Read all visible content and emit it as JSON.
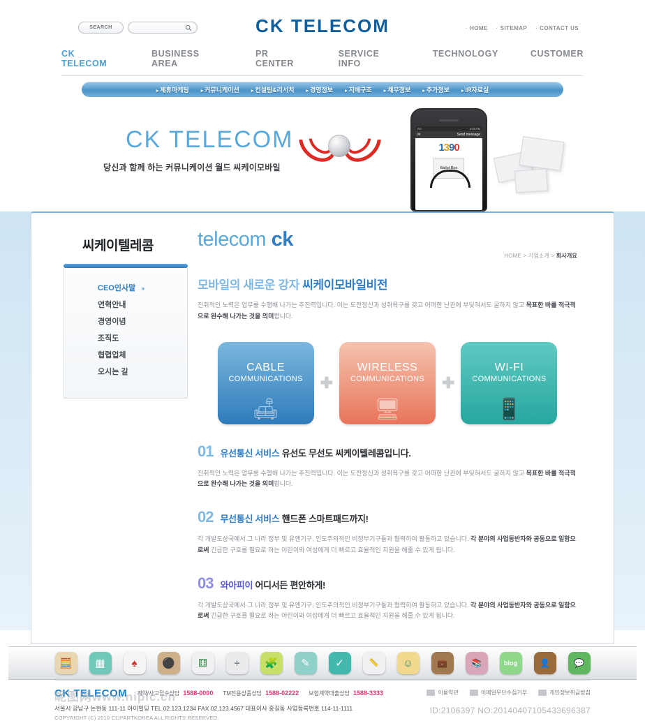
{
  "header": {
    "search_button_label": "SEARCH",
    "search_placeholder": "",
    "search_value": "",
    "brand": "CK TELECOM",
    "util_links": [
      "HOME",
      "SITEMAP",
      "CONTACT US"
    ]
  },
  "mainnav": [
    {
      "label": "CK TELECOM",
      "active": true
    },
    {
      "label": "BUSINESS AREA",
      "active": false
    },
    {
      "label": "PR CENTER",
      "active": false
    },
    {
      "label": "SERVICE INFO",
      "active": false
    },
    {
      "label": "TECHNOLOGY",
      "active": false
    },
    {
      "label": "CUSTOMER",
      "active": false
    }
  ],
  "subnav": [
    "제휴마케팅",
    "커뮤니케이션",
    "컨설팅&리서치",
    "경영정보",
    "지배구조",
    "채무정보",
    "추가정보",
    "IR자료실"
  ],
  "hero": {
    "title": "CK TELECOM",
    "tagline": "당신과 함께 하는 커뮤니케이션 월드 씨케이모바일",
    "phone": {
      "carrier": "RG",
      "time": "8:06 PM",
      "bar_label": "Send message",
      "number_parts": [
        "1",
        "3",
        "9",
        "0"
      ],
      "ballot_label": "Ballot Box"
    }
  },
  "sidebar": {
    "title": "씨케이텔레콤",
    "items": [
      {
        "label": "CEO인사말",
        "active": true
      },
      {
        "label": "연혁안내",
        "active": false
      },
      {
        "label": "경영이념",
        "active": false
      },
      {
        "label": "조직도",
        "active": false
      },
      {
        "label": "협렵업체",
        "active": false
      },
      {
        "label": "오시는 길",
        "active": false
      }
    ]
  },
  "content": {
    "logo_light": "telecom",
    "logo_bold": "ck",
    "breadcrumb_prefix": "HOME > 기업소개 > ",
    "breadcrumb_current": "회사개요",
    "section_title_light": "모바일의 새로운 강자 ",
    "section_title_dark": "씨케이모바일비전",
    "intro_plain_1": "진취적인 노력은 업무를 수행해 나가는 추진력입니다. 이는 도전정신과 성취욕구를 갖고 어떠한 난관에 부딪혀서도 굴하지 않고 ",
    "intro_bold_1": "목표한 바를 적극적으로 완수해 나가는 것을 의미",
    "intro_plain_2": "합니다.",
    "cards": [
      {
        "line1": "CABLE",
        "line2": "COMMUNICATIONS",
        "color": "#2f7cbb",
        "art": "🛋"
      },
      {
        "line1": "WIRELESS",
        "line2": "COMMUNICATIONS",
        "color": "#e8745a",
        "art": "🖥"
      },
      {
        "line1": "WI-FI",
        "line2": "COMMUNICATIONS",
        "color": "#27a79f",
        "art": "📱"
      }
    ],
    "card_separator": "✚",
    "numbered": [
      {
        "num": "01",
        "head_hl": "유선통신 서비스 ",
        "head_rest": "유선도 무선도 씨케이텔레콤입니다.",
        "body_plain_1": "진취적인 노력은 업무를 수행해 나가는 추진력입니다. 이는 도전정신과 성취욕구를 갖고 어떠한 난관에 부딪혀서도 굴하지 않고 ",
        "body_bold": "목표한 바를 적극적으로 완수해 나가는 것을 의미",
        "body_plain_2": "합니다.",
        "style": "blue"
      },
      {
        "num": "02",
        "head_hl": "무선통신 서비스 ",
        "head_rest": "핸드폰 스마트패드까지!",
        "body_plain_1": "각 개발도상국에서 그 나라 정부 및 유엔기구, 인도주의적인 비정부기구들과 협력하여 활동하고 있습니다. ",
        "body_bold": "각 분야의 사업동반자와 공동으로 일함으로써",
        "body_plain_2": " 긴급한 구호를 필요로 하는 어린이와 여성에게 더 빠르고 효율적인 지원을 해줄 수 있게 됩니다.",
        "style": "blue"
      },
      {
        "num": "03",
        "head_hl": "와아피이 ",
        "head_rest": "어디서든 편안하게!",
        "body_plain_1": "각 개발도상국에서 그 나라 정부 및 유엔기구, 인도주의적인 비정부기구들과 협력하여 활동하고 있습니다. ",
        "body_bold": "각 분야의 사업동반자와 공동으로 일함으로써",
        "body_plain_2": " 긴급한 구호를 필요로 하는 어린이와 여성에게 더 빠르고 효율적인 지원을 해줄 수 있게 됩니다.",
        "style": "violet"
      }
    ]
  },
  "dock": [
    {
      "name": "abacus-icon",
      "glyph": "🧮",
      "bg": "#e8d7b0"
    },
    {
      "name": "tetris-icon",
      "glyph": "▦",
      "bg": "#6fc8b8"
    },
    {
      "name": "cards-icon",
      "glyph": "♠",
      "bg": "#f4f4f4",
      "fg": "#d0342c"
    },
    {
      "name": "go-board-icon",
      "glyph": "⚫",
      "bg": "#cdb08a"
    },
    {
      "name": "dice-icon",
      "glyph": "⚅",
      "bg": "#eef0f1",
      "fg": "#3f8f4a"
    },
    {
      "name": "calculator-icon",
      "glyph": "÷",
      "bg": "#e9eaec",
      "fg": "#4a4e54"
    },
    {
      "name": "puzzle-icon",
      "glyph": "🧩",
      "bg": "#c8e06a"
    },
    {
      "name": "blackboard-icon",
      "glyph": "✎",
      "bg": "#8fd0c8"
    },
    {
      "name": "checkmark-icon",
      "glyph": "✓",
      "bg": "#43b8ad"
    },
    {
      "name": "ruler-icon",
      "glyph": "📏",
      "bg": "#eef0f2",
      "fg": "#4a4e54"
    },
    {
      "name": "family-icon",
      "glyph": "☺",
      "bg": "#f2d98e"
    },
    {
      "name": "suitcase-icon",
      "glyph": "💼",
      "bg": "#a07a4e"
    },
    {
      "name": "books-icon",
      "glyph": "📚",
      "bg": "#d9a5b8"
    },
    {
      "name": "blog-icon",
      "glyph": "blog",
      "bg": "#8fd88a"
    },
    {
      "name": "contacts-icon",
      "glyph": "👤",
      "bg": "#9b6a3a"
    },
    {
      "name": "chat-icon",
      "glyph": "💬",
      "bg": "#5fb85f"
    }
  ],
  "footer": {
    "logo": "CK TELECOM",
    "calls": [
      {
        "label": "계약/사고접수상담",
        "tel": "1588-0000"
      },
      {
        "label": "TM전용상품상담",
        "tel": "1588-02222"
      },
      {
        "label": "보험계약대출상담",
        "tel": "1588-3333"
      }
    ],
    "links": [
      "이용약관",
      "이메일무단수집거부",
      "개인정보취급방침"
    ],
    "address": "서울시 강남구 논현동 111-11 아이빌딩   TEL 02.123.1234   FAX 02.123.4567   대표이사 홍길동 사업등록번호 114-11-1111",
    "copyright": "COPYRIGHT (C) 2010 CLIPARTKOREA ALL RIGHTS RESERVED.",
    "watermark": "昵图网www.nipic.cn",
    "id_tag": "ID:2106397 NO:20140407105433696387"
  }
}
